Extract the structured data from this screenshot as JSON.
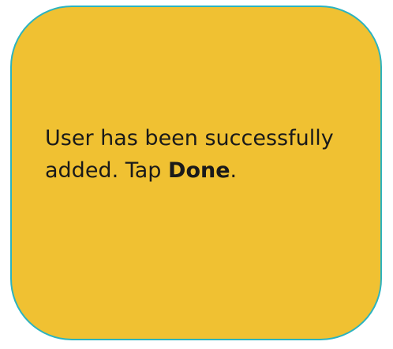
{
  "callout": {
    "line1": "User has been successfully",
    "line2_prefix": "added. Tap ",
    "line2_emphasis": "Done",
    "line2_suffix": ".",
    "background_color": "#f0c132",
    "border_color": "#2bb3c0",
    "text_color": "#1a1a1a"
  }
}
